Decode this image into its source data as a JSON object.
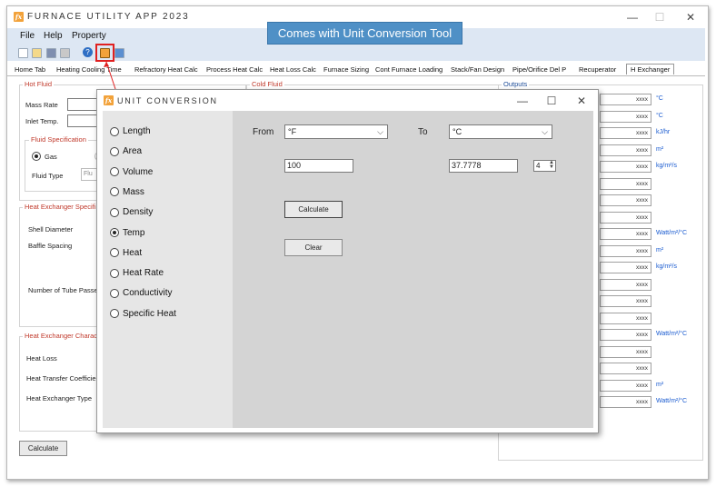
{
  "app": {
    "title": "FURNACE UTILITY APP 2023",
    "logo_text": "fx",
    "window_controls": {
      "minimize": "—",
      "maximize": "☐",
      "close": "✕"
    }
  },
  "menu": {
    "file": "File",
    "help": "Help",
    "property": "Property"
  },
  "callout": "Comes with Unit Conversion Tool",
  "tabs": [
    "Home Tab",
    "Heating Cooling Time",
    "Refractory Heat Calc",
    "Process Heat Calc",
    "Heat Loss Calc",
    "Furnace Sizing",
    "Cont Furnace Loading",
    "Stack/Fan Design",
    "Pipe/Orifice Del P",
    "Recuperator",
    "H Exchanger"
  ],
  "active_tab": "H Exchanger",
  "hot_fluid": {
    "title": "Hot Fluid",
    "mass_rate_label": "Mass Rate",
    "inlet_temp_label": "Inlet Temp.",
    "fluid_spec": {
      "title": "Fluid Specification",
      "gas_label": "Gas",
      "fluid_type_label": "Fluid Type",
      "fluid_type_value": "Flu"
    }
  },
  "cold_fluid": {
    "title": "Cold Fluid"
  },
  "hx_spec": {
    "title": "Heat Exchanger Specifi",
    "shell_diameter_label": "Shell Diameter",
    "baffle_spacing_label": "Baffle Spacing",
    "tube_passes_label": "Number of Tube Passe"
  },
  "hx_char": {
    "title": "Heat Exchanger Charac",
    "heat_loss_label": "Heat Loss",
    "htc_label": "Heat Transfer Coefficie",
    "type_label": "Heat Exchanger Type"
  },
  "calculate_button": "Calculate",
  "outputs": {
    "title": "Outputs",
    "rows": [
      {
        "value": "xxxx",
        "unit": "°C"
      },
      {
        "value": "xxxx",
        "unit": "°C"
      },
      {
        "value": "xxxx",
        "unit": "kJ/hr"
      },
      {
        "value": "xxxx",
        "unit": "m²"
      },
      {
        "value": "xxxx",
        "unit": "kg/m²/s"
      },
      {
        "value": "xxxx",
        "unit": ""
      },
      {
        "value": "xxxx",
        "unit": ""
      },
      {
        "value": "xxxx",
        "unit": ""
      },
      {
        "value": "xxxx",
        "unit": "Watt/m²/°C"
      },
      {
        "value": "xxxx",
        "unit": "m²"
      },
      {
        "value": "xxxx",
        "unit": "kg/m²/s"
      },
      {
        "value": "xxxx",
        "unit": ""
      },
      {
        "value": "xxxx",
        "unit": ""
      },
      {
        "value": "xxxx",
        "unit": ""
      },
      {
        "value": "xxxx",
        "unit": "Watt/m²/°C"
      },
      {
        "value": "xxxx",
        "unit": ""
      },
      {
        "value": "xxxx",
        "unit": ""
      },
      {
        "value": "xxxx",
        "unit": "m²"
      },
      {
        "value": "xxxx",
        "unit": "Watt/m²/°C"
      }
    ]
  },
  "dialog": {
    "title": "UNIT CONVERSION",
    "logo_text": "fx",
    "controls": {
      "minimize": "—",
      "maximize": "☐",
      "close": "✕"
    },
    "quantities": [
      "Length",
      "Area",
      "Volume",
      "Mass",
      "Density",
      "Temp",
      "Heat",
      "Heat Rate",
      "Conductivity",
      "Specific Heat"
    ],
    "selected_quantity": "Temp",
    "from_label": "From",
    "to_label": "To",
    "from_unit": "°F",
    "to_unit": "°C",
    "from_value": "100",
    "to_value": "37.7778",
    "decimals": "4",
    "calculate": "Calculate",
    "clear": "Clear"
  },
  "colors": {
    "accent": "#4f90c6",
    "section_title": "#c0392b",
    "unit_text": "#1a5bd0",
    "menubar": "#dde7f3",
    "dialog_panel": "#d4d4d4"
  }
}
